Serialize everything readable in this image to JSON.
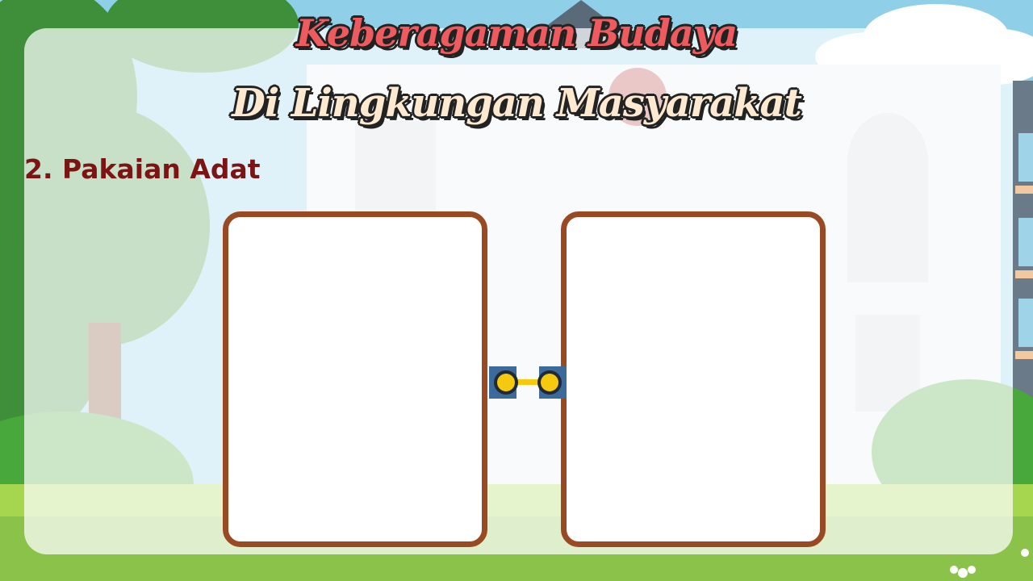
{
  "slide": {
    "title_line1": "Keberagaman Budaya",
    "title_line2": "Di Lingkungan Masyarakat",
    "section_heading": "2. Pakaian Adat"
  },
  "colors": {
    "title_line1": "#ee5b5e",
    "title_line2": "#fde9cf",
    "heading": "#7b1413",
    "frame_border": "#9a4a22",
    "connector_block": "#3b6a9b",
    "connector_knob": "#f6c90e"
  }
}
